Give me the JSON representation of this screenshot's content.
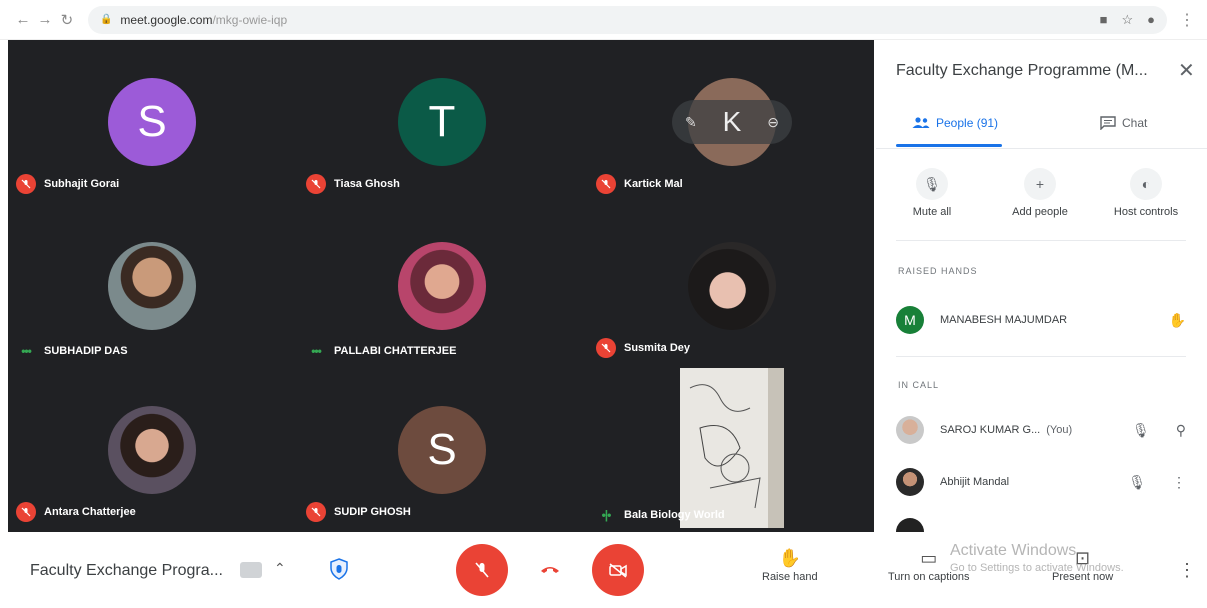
{
  "browser": {
    "url_host": "meet.google.com",
    "url_path": "/mkg-owie-iqp"
  },
  "tiles": [
    {
      "name": "Subhajit Gorai",
      "initial": "S",
      "color": "#9c5bd8",
      "status": "muted"
    },
    {
      "name": "Tiasa Ghosh",
      "initial": "T",
      "color": "#0b5a47",
      "status": "muted"
    },
    {
      "name": "Kartick Mal",
      "initial": "K",
      "color": "#8a6a5a",
      "status": "muted"
    },
    {
      "name": "SUBHADIP DAS",
      "status": "speaking"
    },
    {
      "name": "PALLABI CHATTERJEE",
      "status": "speaking"
    },
    {
      "name": "Susmita Dey",
      "status": "muted"
    },
    {
      "name": "Antara Chatterjee",
      "status": "muted"
    },
    {
      "name": "SUDIP GHOSH",
      "initial": "S",
      "color": "#6d4b3e",
      "status": "muted"
    },
    {
      "name": "Bala Biology World",
      "status": "audio"
    }
  ],
  "toolbar": {
    "meeting_name": "Faculty Exchange Progra...",
    "raise_hand": "Raise hand",
    "captions": "Turn on captions",
    "present": "Present now",
    "watermark_title": "Activate Windows",
    "watermark_sub": "Go to Settings to activate Windows."
  },
  "panel": {
    "title": "Faculty Exchange Programme (M...",
    "tab_people": "People (91)",
    "tab_chat": "Chat",
    "action_mute": "Mute all",
    "action_add": "Add people",
    "action_host": "Host controls",
    "raised_label": "RAISED HANDS",
    "raised": [
      {
        "name": "MANABESH MAJUMDAR",
        "initial": "M",
        "color": "#188038"
      }
    ],
    "incall_label": "IN CALL",
    "incall": [
      {
        "name": "SAROJ KUMAR G...",
        "you": "(You)"
      },
      {
        "name": "Abhijit Mandal"
      }
    ]
  }
}
